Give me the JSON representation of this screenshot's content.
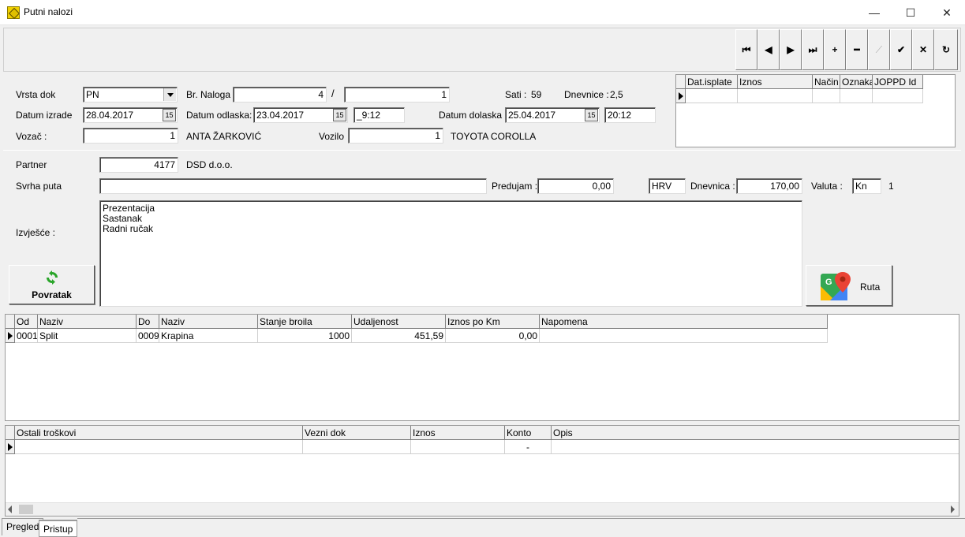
{
  "window": {
    "title": "Putni nalozi",
    "minimize": "—",
    "maximize": "☐",
    "close": "✕"
  },
  "toolbar": {
    "first": "⏮",
    "prev": "◀",
    "next": "▶",
    "last": "⏭",
    "add": "+",
    "delete": "━",
    "edit": "⟋",
    "confirm": "✔",
    "cancel": "✕",
    "refresh": "↻"
  },
  "form": {
    "vrsta_dok": {
      "label": "Vrsta dok",
      "value": "PN"
    },
    "datum_izrade": {
      "label": "Datum izrade",
      "value": "28.04.2017"
    },
    "vozac": {
      "label": "Vozač :",
      "value": "1",
      "name": "ANTA ŽARKOVIĆ"
    },
    "br_naloga": {
      "label": "Br. Naloga",
      "value": "4",
      "separator": "/",
      "value2": "1"
    },
    "datum_odlaska": {
      "label": "Datum odlaska:",
      "value": "23.04.2017",
      "time": "_9:12"
    },
    "vozilo": {
      "label": "Vozilo",
      "value": "1",
      "name": "TOYOTA COROLLA"
    },
    "sati": {
      "label": "Sati :",
      "value": "59"
    },
    "dnevnice": {
      "label": "Dnevnice :",
      "value": "2,5"
    },
    "datum_dolaska": {
      "label": "Datum dolaska :",
      "value": "25.04.2017",
      "time": "20:12"
    },
    "cal_icon": "15",
    "partner": {
      "label": "Partner",
      "value": "4177",
      "name": "DSD d.o.o."
    },
    "svrha_puta": {
      "label": "Svrha puta",
      "value": ""
    },
    "predujam": {
      "label": "Predujam :",
      "value": "0,00",
      "currency": "HRV"
    },
    "dnevnica": {
      "label": "Dnevnica :",
      "value": "170,00"
    },
    "valuta": {
      "label": "Valuta :",
      "value": "Kn",
      "rate": "1"
    },
    "izvjesce": {
      "label": "Izvješće  :",
      "lines": [
        "Prezentacija",
        "Sastanak",
        "Radni ručak"
      ]
    }
  },
  "buttons": {
    "povratak": "Povratak",
    "ruta": "Ruta"
  },
  "payments_grid": {
    "headers": [
      "Dat.isplate",
      "Iznos",
      "Način",
      "Oznaka",
      "JOPPD Id"
    ]
  },
  "route_grid": {
    "headers": [
      "Od",
      "Naziv",
      "Do",
      "Naziv",
      "Stanje broila",
      "Udaljenost",
      "Iznos po Km",
      "Napomena"
    ],
    "rows": [
      {
        "od": "0001",
        "naziv_od": "Split",
        "do": "0009",
        "naziv_do": "Krapina",
        "stanje": "1000",
        "udaljenost": "451,59",
        "iznos_km": "0,00",
        "napomena": ""
      }
    ]
  },
  "costs_grid": {
    "headers": [
      "Ostali troškovi",
      "Vezni dok",
      "Iznos",
      "Konto",
      "Opis"
    ],
    "rows": [
      {
        "ostali": "",
        "vezni": "",
        "iznos": "",
        "konto": "-",
        "opis": ""
      }
    ]
  },
  "tabs": [
    "Pregled",
    "Pristup"
  ]
}
